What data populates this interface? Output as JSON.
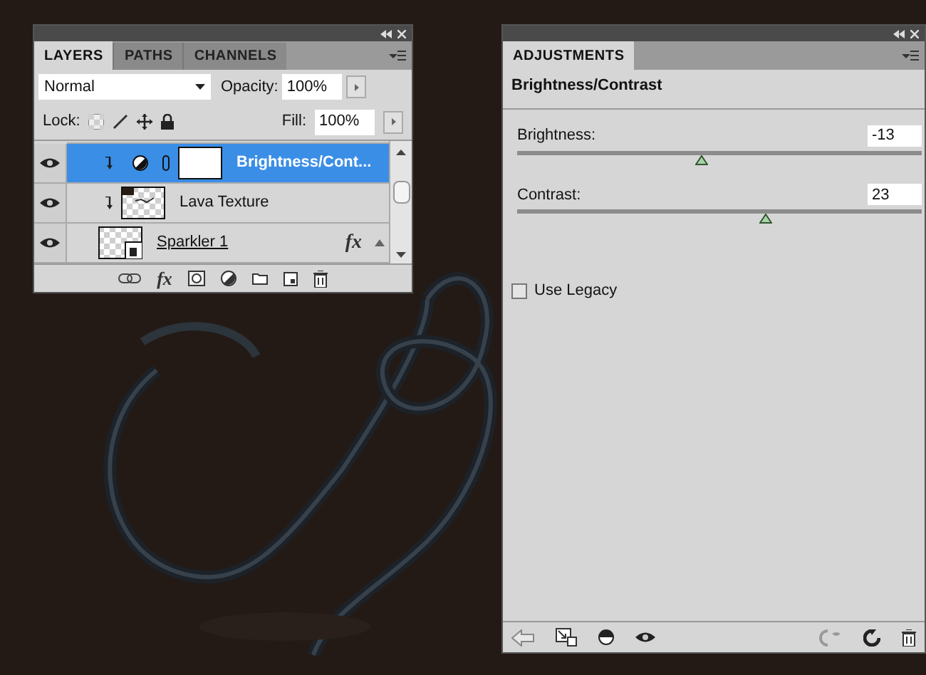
{
  "layers_panel": {
    "tabs": [
      {
        "label": "LAYERS",
        "selected": true
      },
      {
        "label": "PATHS",
        "selected": false
      },
      {
        "label": "CHANNELS",
        "selected": false
      }
    ],
    "blend_mode": "Normal",
    "opacity_label": "Opacity:",
    "opacity": "100%",
    "lock_label": "Lock:",
    "fill_label": "Fill:",
    "fill": "100%",
    "layers": [
      {
        "kind": "adjustment",
        "name": "Brightness/Cont...",
        "selected": true,
        "visible": true,
        "clipped": true
      },
      {
        "kind": "pixel",
        "name": "Lava Texture",
        "selected": false,
        "visible": true,
        "clipped": true
      },
      {
        "kind": "smart",
        "name": "Sparkler 1",
        "selected": false,
        "visible": true,
        "clipped": false,
        "effects": "fx"
      }
    ],
    "toolbar_fx": "fx"
  },
  "adjustments_panel": {
    "tabs": [
      {
        "label": "ADJUSTMENTS",
        "selected": true
      }
    ],
    "title": "Brightness/Contrast",
    "sliders": [
      {
        "label": "Brightness:",
        "value": "-13",
        "level": 0.456
      },
      {
        "label": "Contrast:",
        "value": "23",
        "level": 0.614
      }
    ],
    "use_legacy": {
      "label": "Use Legacy",
      "checked": false
    }
  }
}
